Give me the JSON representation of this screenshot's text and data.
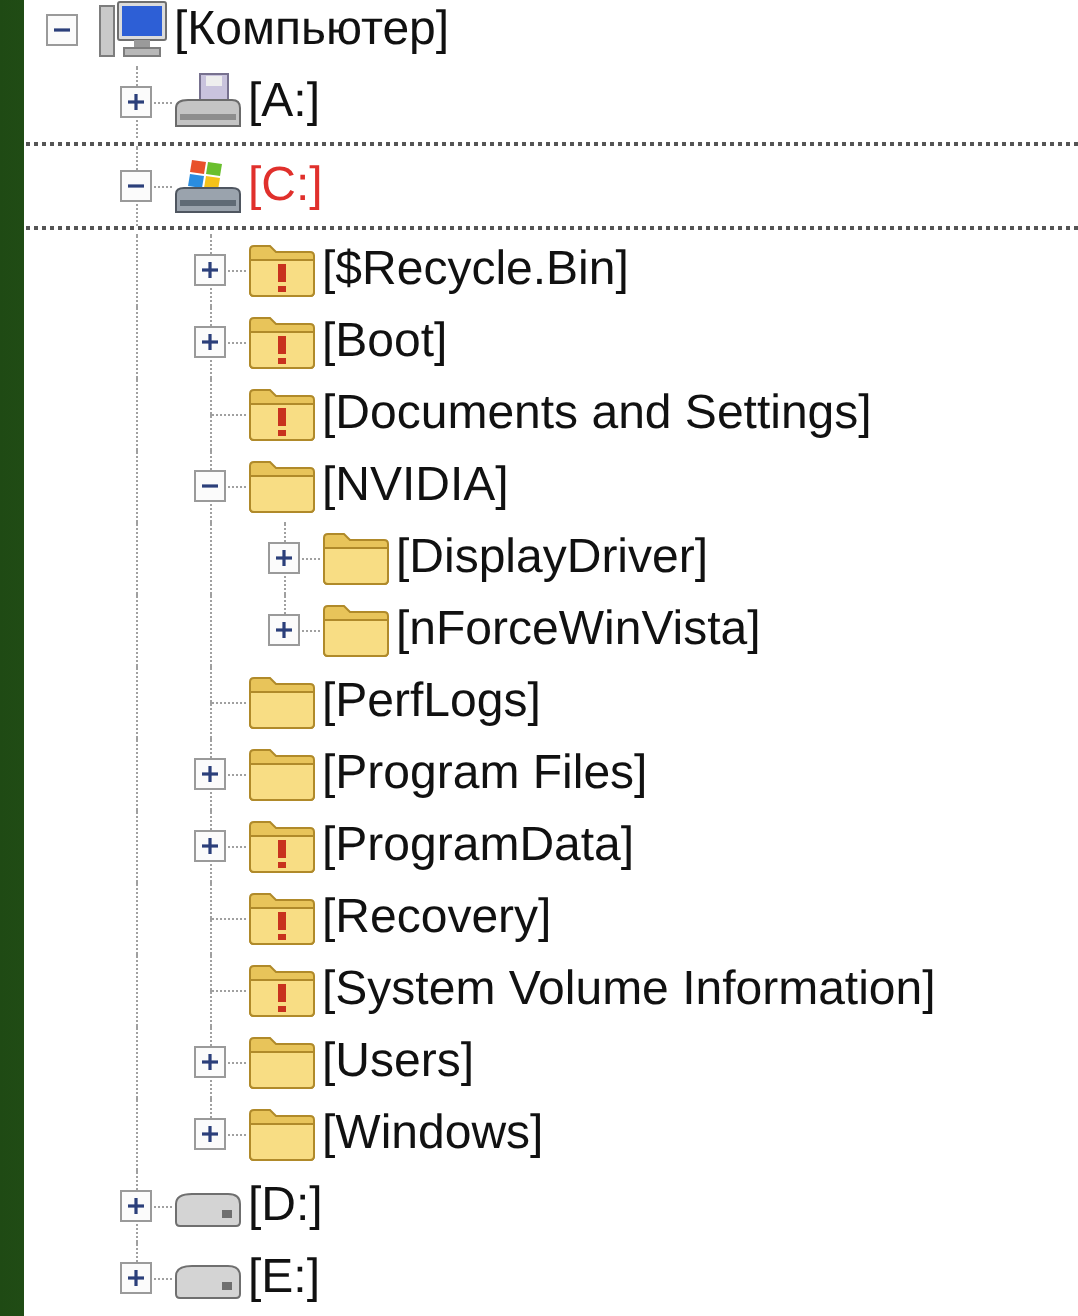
{
  "tree": {
    "label": "[Компьютер]",
    "kind": "computer",
    "has_children": true,
    "expanded": true,
    "selected": false,
    "children": [
      {
        "label": "[A:]",
        "kind": "floppy",
        "has_children": true,
        "expanded": false,
        "selected": false
      },
      {
        "label": "[C:]",
        "kind": "system-drive",
        "has_children": true,
        "expanded": true,
        "selected": true,
        "children": [
          {
            "label": "[$Recycle.Bin]",
            "kind": "folder",
            "restricted": true,
            "has_children": true,
            "expanded": false,
            "selected": false
          },
          {
            "label": "[Boot]",
            "kind": "folder",
            "restricted": true,
            "has_children": true,
            "expanded": false,
            "selected": false
          },
          {
            "label": "[Documents and Settings]",
            "kind": "folder",
            "restricted": true,
            "has_children": false,
            "selected": false
          },
          {
            "label": "[NVIDIA]",
            "kind": "folder",
            "restricted": false,
            "has_children": true,
            "expanded": true,
            "selected": false,
            "children": [
              {
                "label": "[DisplayDriver]",
                "kind": "folder",
                "restricted": false,
                "has_children": true,
                "expanded": false,
                "selected": false
              },
              {
                "label": "[nForceWinVista]",
                "kind": "folder",
                "restricted": false,
                "has_children": true,
                "expanded": false,
                "selected": false
              }
            ]
          },
          {
            "label": "[PerfLogs]",
            "kind": "folder",
            "restricted": false,
            "has_children": false,
            "selected": false
          },
          {
            "label": "[Program Files]",
            "kind": "folder",
            "restricted": false,
            "has_children": true,
            "expanded": false,
            "selected": false
          },
          {
            "label": "[ProgramData]",
            "kind": "folder",
            "restricted": true,
            "has_children": true,
            "expanded": false,
            "selected": false
          },
          {
            "label": "[Recovery]",
            "kind": "folder",
            "restricted": true,
            "has_children": false,
            "selected": false
          },
          {
            "label": "[System Volume Information]",
            "kind": "folder",
            "restricted": true,
            "has_children": false,
            "selected": false
          },
          {
            "label": "[Users]",
            "kind": "folder",
            "restricted": false,
            "has_children": true,
            "expanded": false,
            "selected": false
          },
          {
            "label": "[Windows]",
            "kind": "folder",
            "restricted": false,
            "has_children": true,
            "expanded": false,
            "selected": false
          }
        ]
      },
      {
        "label": "[D:]",
        "kind": "drive",
        "has_children": true,
        "expanded": false,
        "selected": false
      },
      {
        "label": "[E:]",
        "kind": "drive",
        "has_children": true,
        "expanded": false,
        "selected": false
      }
    ]
  }
}
